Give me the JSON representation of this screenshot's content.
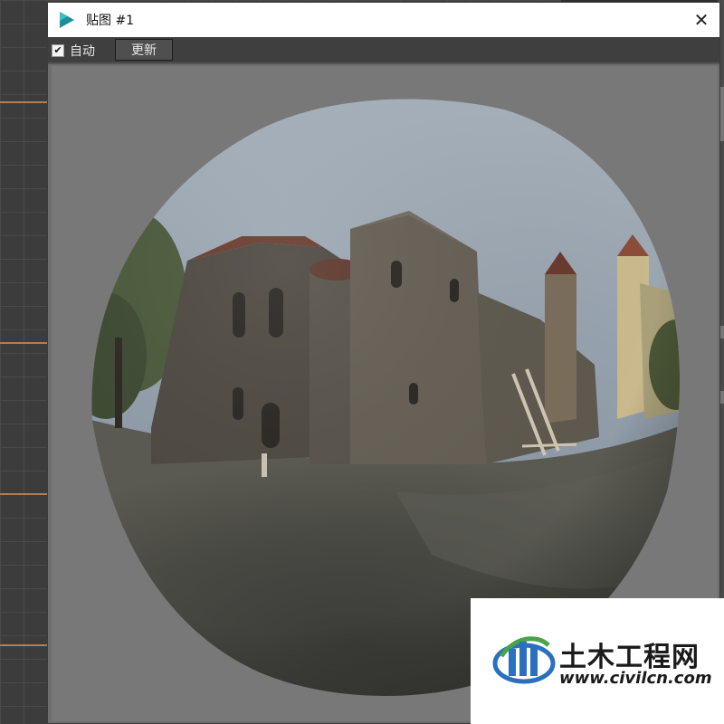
{
  "window": {
    "title": "贴图 #1",
    "close_glyph": "✕",
    "app_icon": "3dsmax-logo-icon"
  },
  "toolbar": {
    "auto_label": "自动",
    "auto_checked": true,
    "check_glyph": "✔",
    "update_label": "更新"
  },
  "preview": {
    "content": "hdri-sphere-church"
  },
  "watermark": {
    "name": "土木工程网",
    "url": "www.civilcn.com"
  },
  "colors": {
    "accent_orange": "#b07e58",
    "titlebar_bg": "#ffffff",
    "toolbar_bg": "#3f3f3f",
    "canvas_bg": "#787878",
    "logo_blue": "#2a6fc0",
    "logo_green": "#4aa34a"
  }
}
